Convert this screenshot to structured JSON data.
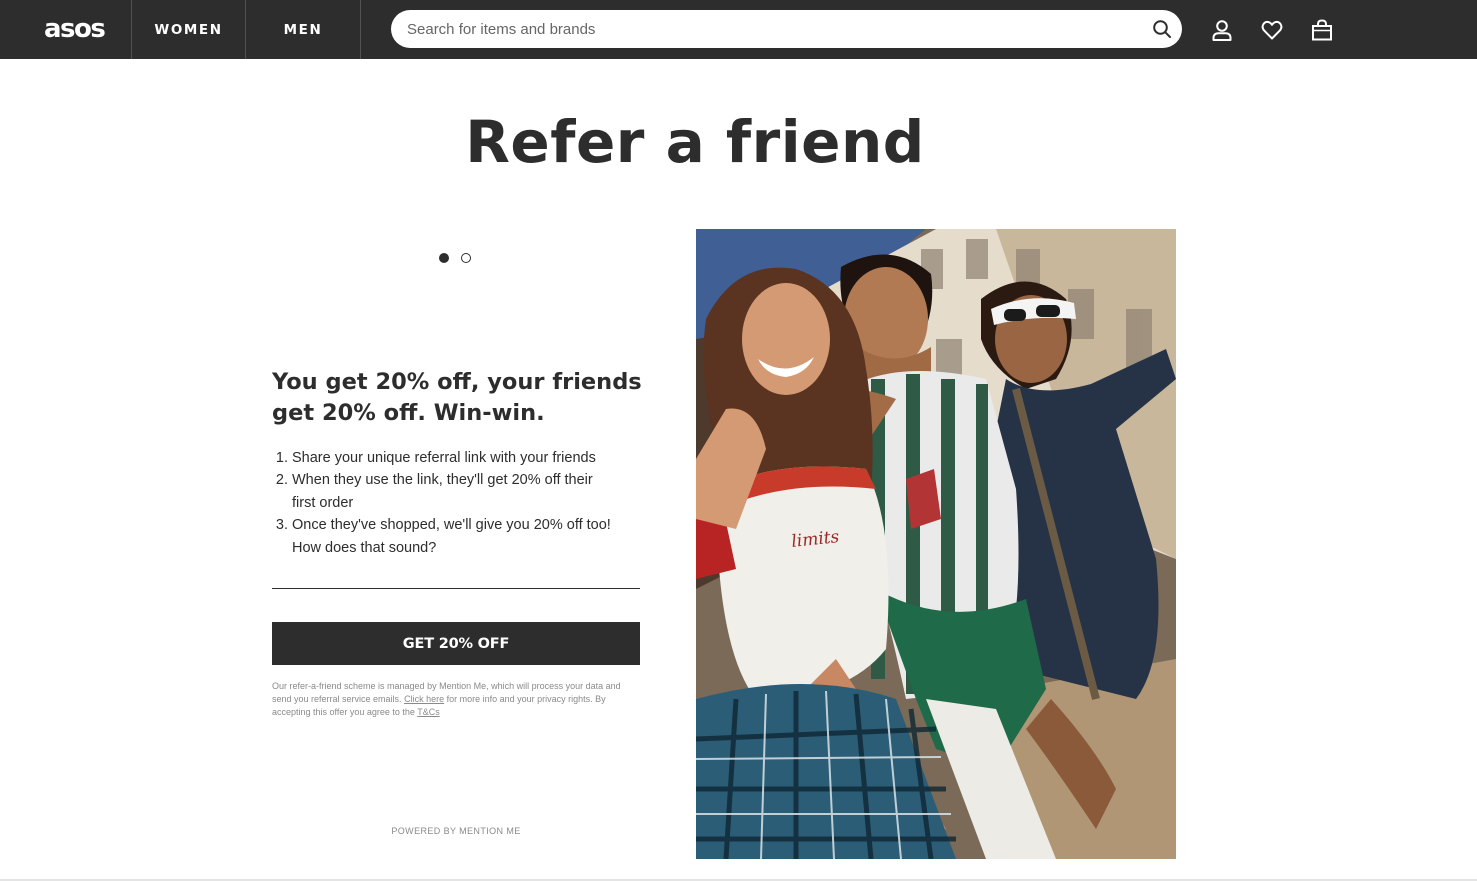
{
  "nav": {
    "logo": "asos",
    "women": "WOMEN",
    "men": "MEN",
    "search_placeholder": "Search for items and brands",
    "icons": [
      "search-icon",
      "account-icon",
      "heart-icon",
      "bag-icon"
    ]
  },
  "page": {
    "title": "Refer a friend"
  },
  "carousel": {
    "total": 2,
    "active": 1
  },
  "offer": {
    "heading": "You get 20% off, your friends get 20% off. Win-win.",
    "steps": [
      "Share your unique referral link with your friends",
      "When they use the link, they'll get 20% off their first order",
      "Once they've shopped, we'll give you 20% off too! How does that sound?"
    ],
    "cta": "GET 20% OFF",
    "fineprint_1": "Our refer-a-friend scheme is managed by Mention Me, which will process your data and send you referral service emails.",
    "fineprint_link_1": "Click here",
    "fineprint_2": "for more info and your privacy rights. By accepting this offer you agree to the",
    "fineprint_link_2": "T&Cs",
    "powered_by": "POWERED BY MENTION ME"
  },
  "hero": {
    "shirt_text": "limits"
  },
  "colors": {
    "nav_bg": "#2d2d2d",
    "text": "#2d2d2d",
    "button_bg": "#2d2d2d",
    "fine_text": "#8a8a8a"
  }
}
